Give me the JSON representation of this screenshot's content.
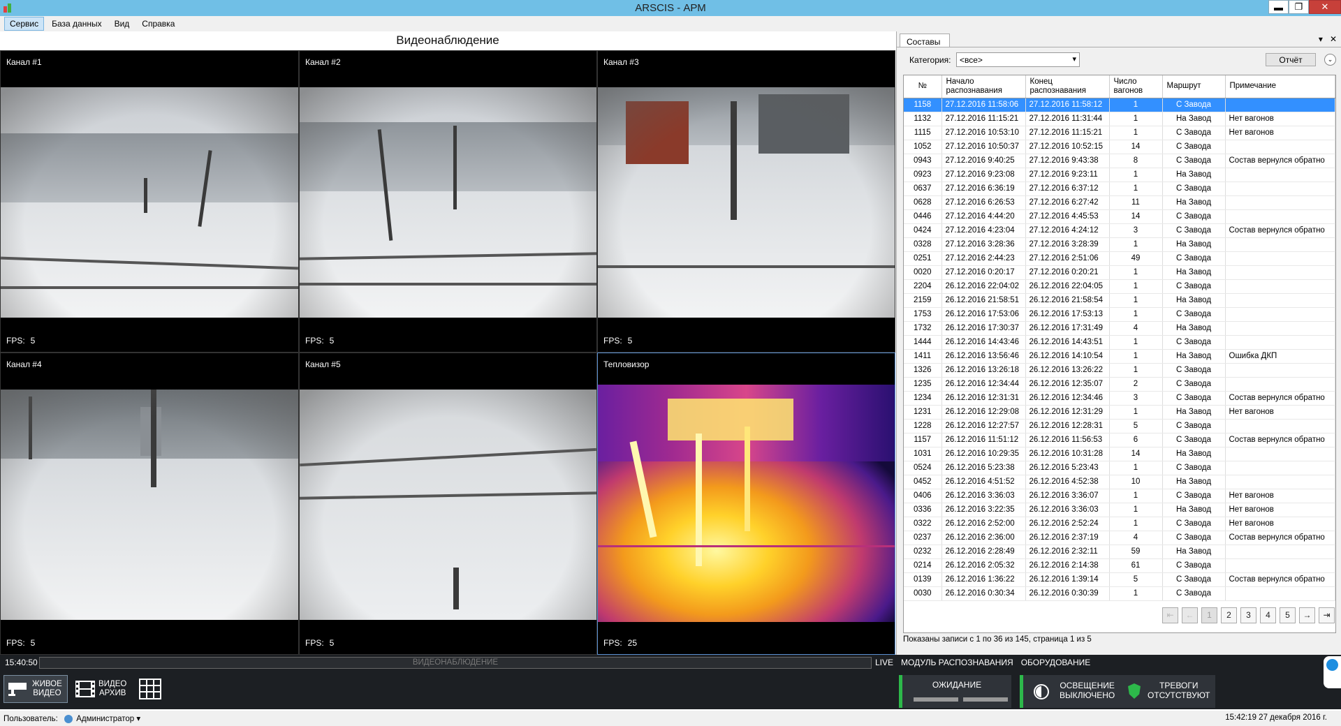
{
  "window": {
    "title": "ARSCIS - АРМ",
    "minimize": "▬",
    "restore": "❐",
    "close": "✕"
  },
  "menu": [
    "Сервис",
    "База данных",
    "Вид",
    "Справка"
  ],
  "video": {
    "title": "Видеонаблюдение",
    "fps_label": "FPS:",
    "channels": [
      {
        "name": "Канал #1",
        "fps": "5"
      },
      {
        "name": "Канал #2",
        "fps": "5"
      },
      {
        "name": "Канал #3",
        "fps": "5"
      },
      {
        "name": "Канал #4",
        "fps": "5"
      },
      {
        "name": "Канал #5",
        "fps": "5"
      },
      {
        "name": "Тепловизор",
        "fps": "25"
      }
    ]
  },
  "panel": {
    "tab": "Составы",
    "pin_icon": "▾",
    "close_icon": "✕",
    "category_label": "Категория:",
    "category_value": "<все>",
    "report_button": "Отчёт",
    "columns": [
      "№",
      "Начало распознавания",
      "Конец распознавания",
      "Число вагонов",
      "Маршрут",
      "Примечание"
    ],
    "rows": [
      [
        "1158",
        "27.12.2016 11:58:06",
        "27.12.2016 11:58:12",
        "1",
        "С Завода",
        ""
      ],
      [
        "1132",
        "27.12.2016 11:15:21",
        "27.12.2016 11:31:44",
        "1",
        "На Завод",
        "Нет вагонов"
      ],
      [
        "1115",
        "27.12.2016 10:53:10",
        "27.12.2016 11:15:21",
        "1",
        "С Завода",
        "Нет вагонов"
      ],
      [
        "1052",
        "27.12.2016 10:50:37",
        "27.12.2016 10:52:15",
        "14",
        "С Завода",
        ""
      ],
      [
        "0943",
        "27.12.2016 9:40:25",
        "27.12.2016 9:43:38",
        "8",
        "С Завода",
        "Состав вернулся обратно"
      ],
      [
        "0923",
        "27.12.2016 9:23:08",
        "27.12.2016 9:23:11",
        "1",
        "На Завод",
        ""
      ],
      [
        "0637",
        "27.12.2016 6:36:19",
        "27.12.2016 6:37:12",
        "1",
        "С Завода",
        ""
      ],
      [
        "0628",
        "27.12.2016 6:26:53",
        "27.12.2016 6:27:42",
        "11",
        "На Завод",
        ""
      ],
      [
        "0446",
        "27.12.2016 4:44:20",
        "27.12.2016 4:45:53",
        "14",
        "С Завода",
        ""
      ],
      [
        "0424",
        "27.12.2016 4:23:04",
        "27.12.2016 4:24:12",
        "3",
        "С Завода",
        "Состав вернулся обратно"
      ],
      [
        "0328",
        "27.12.2016 3:28:36",
        "27.12.2016 3:28:39",
        "1",
        "На Завод",
        ""
      ],
      [
        "0251",
        "27.12.2016 2:44:23",
        "27.12.2016 2:51:06",
        "49",
        "С Завода",
        ""
      ],
      [
        "0020",
        "27.12.2016 0:20:17",
        "27.12.2016 0:20:21",
        "1",
        "На Завод",
        ""
      ],
      [
        "2204",
        "26.12.2016 22:04:02",
        "26.12.2016 22:04:05",
        "1",
        "С Завода",
        ""
      ],
      [
        "2159",
        "26.12.2016 21:58:51",
        "26.12.2016 21:58:54",
        "1",
        "На Завод",
        ""
      ],
      [
        "1753",
        "26.12.2016 17:53:06",
        "26.12.2016 17:53:13",
        "1",
        "С Завода",
        ""
      ],
      [
        "1732",
        "26.12.2016 17:30:37",
        "26.12.2016 17:31:49",
        "4",
        "На Завод",
        ""
      ],
      [
        "1444",
        "26.12.2016 14:43:46",
        "26.12.2016 14:43:51",
        "1",
        "С Завода",
        ""
      ],
      [
        "1411",
        "26.12.2016 13:56:46",
        "26.12.2016 14:10:54",
        "1",
        "На Завод",
        "Ошибка ДКП"
      ],
      [
        "1326",
        "26.12.2016 13:26:18",
        "26.12.2016 13:26:22",
        "1",
        "С Завода",
        ""
      ],
      [
        "1235",
        "26.12.2016 12:34:44",
        "26.12.2016 12:35:07",
        "2",
        "С Завода",
        ""
      ],
      [
        "1234",
        "26.12.2016 12:31:31",
        "26.12.2016 12:34:46",
        "3",
        "С Завода",
        "Состав вернулся обратно"
      ],
      [
        "1231",
        "26.12.2016 12:29:08",
        "26.12.2016 12:31:29",
        "1",
        "На Завод",
        "Нет вагонов"
      ],
      [
        "1228",
        "26.12.2016 12:27:57",
        "26.12.2016 12:28:31",
        "5",
        "С Завода",
        ""
      ],
      [
        "1157",
        "26.12.2016 11:51:12",
        "26.12.2016 11:56:53",
        "6",
        "С Завода",
        "Состав вернулся обратно"
      ],
      [
        "1031",
        "26.12.2016 10:29:35",
        "26.12.2016 10:31:28",
        "14",
        "На Завод",
        ""
      ],
      [
        "0524",
        "26.12.2016 5:23:38",
        "26.12.2016 5:23:43",
        "1",
        "С Завода",
        ""
      ],
      [
        "0452",
        "26.12.2016 4:51:52",
        "26.12.2016 4:52:38",
        "10",
        "На Завод",
        ""
      ],
      [
        "0406",
        "26.12.2016 3:36:03",
        "26.12.2016 3:36:07",
        "1",
        "С Завода",
        "Нет вагонов"
      ],
      [
        "0336",
        "26.12.2016 3:22:35",
        "26.12.2016 3:36:03",
        "1",
        "На Завод",
        "Нет вагонов"
      ],
      [
        "0322",
        "26.12.2016 2:52:00",
        "26.12.2016 2:52:24",
        "1",
        "С Завода",
        "Нет вагонов"
      ],
      [
        "0237",
        "26.12.2016 2:36:00",
        "26.12.2016 2:37:19",
        "4",
        "С Завода",
        "Состав вернулся обратно"
      ],
      [
        "0232",
        "26.12.2016 2:28:49",
        "26.12.2016 2:32:11",
        "59",
        "На Завод",
        ""
      ],
      [
        "0214",
        "26.12.2016 2:05:32",
        "26.12.2016 2:14:38",
        "61",
        "С Завода",
        ""
      ],
      [
        "0139",
        "26.12.2016 1:36:22",
        "26.12.2016 1:39:14",
        "5",
        "С Завода",
        "Состав вернулся обратно"
      ],
      [
        "0030",
        "26.12.2016 0:30:34",
        "26.12.2016 0:30:39",
        "1",
        "С Завода",
        ""
      ]
    ],
    "pager": {
      "first": "⇤",
      "prev": "←",
      "pages": [
        "1",
        "2",
        "3",
        "4",
        "5"
      ],
      "next": "→",
      "last": "⇥",
      "current": "1"
    },
    "pager_info": "Показаны записи с 1 по 36 из 145, страница 1 из 5"
  },
  "statusbar": {
    "time": "15:40:50",
    "mode": "ВИДЕОНАБЛЮДЕНИЕ",
    "tabs": [
      "LIVE",
      "МОДУЛЬ РАСПОЗНАВАНИЯ",
      "ОБОРУДОВАНИЕ"
    ]
  },
  "bottom": {
    "live_video": "ЖИВОЕ\nВИДЕО",
    "video_archive": "ВИДЕО\nАРХИВ",
    "waiting": "ОЖИДАНИЕ",
    "lighting": "ОСВЕЩЕНИЕ\nВЫКЛЮЧЕНО",
    "alarms": "ТРЕВОГИ\nОТСУТСТВУЮТ",
    "status_color": "#2db84a"
  },
  "footer": {
    "user_label": "Пользователь:",
    "user_name": "Администратор",
    "datetime": "15:42:19  27 декабря 2016 г."
  }
}
